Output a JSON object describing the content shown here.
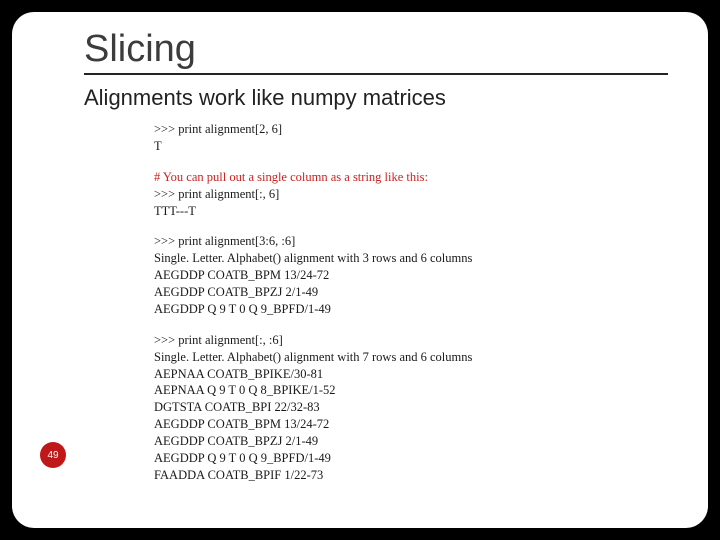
{
  "title": "Slicing",
  "subtitle": "Alignments work like numpy matrices",
  "page_number": "49",
  "code": {
    "b1": {
      "l1": ">>> print alignment[2, 6]",
      "l2": "T"
    },
    "b2": {
      "l1": "# You can pull out a single column as a string like this:",
      "l2": ">>> print alignment[:, 6]",
      "l3": "TTT---T"
    },
    "b3": {
      "l1": ">>> print alignment[3:6, :6]",
      "l2": "Single. Letter. Alphabet() alignment with 3 rows and 6 columns",
      "l3": "AEGDDP COATB_BPM 13/24-72",
      "l4": "AEGDDP COATB_BPZJ 2/1-49",
      "l5": "AEGDDP Q 9 T 0 Q 9_BPFD/1-49"
    },
    "b4": {
      "l1": ">>> print alignment[:, :6]",
      "l2": "Single. Letter. Alphabet() alignment with 7 rows and 6 columns",
      "l3": "AEPNAA COATB_BPIKE/30-81",
      "l4": "AEPNAA Q 9 T 0 Q 8_BPIKE/1-52",
      "l5": "DGTSTA COATB_BPI 22/32-83",
      "l6": "AEGDDP COATB_BPM 13/24-72",
      "l7": "AEGDDP COATB_BPZJ 2/1-49",
      "l8": "AEGDDP Q 9 T 0 Q 9_BPFD/1-49",
      "l9": "FAADDA COATB_BPIF 1/22-73"
    }
  }
}
